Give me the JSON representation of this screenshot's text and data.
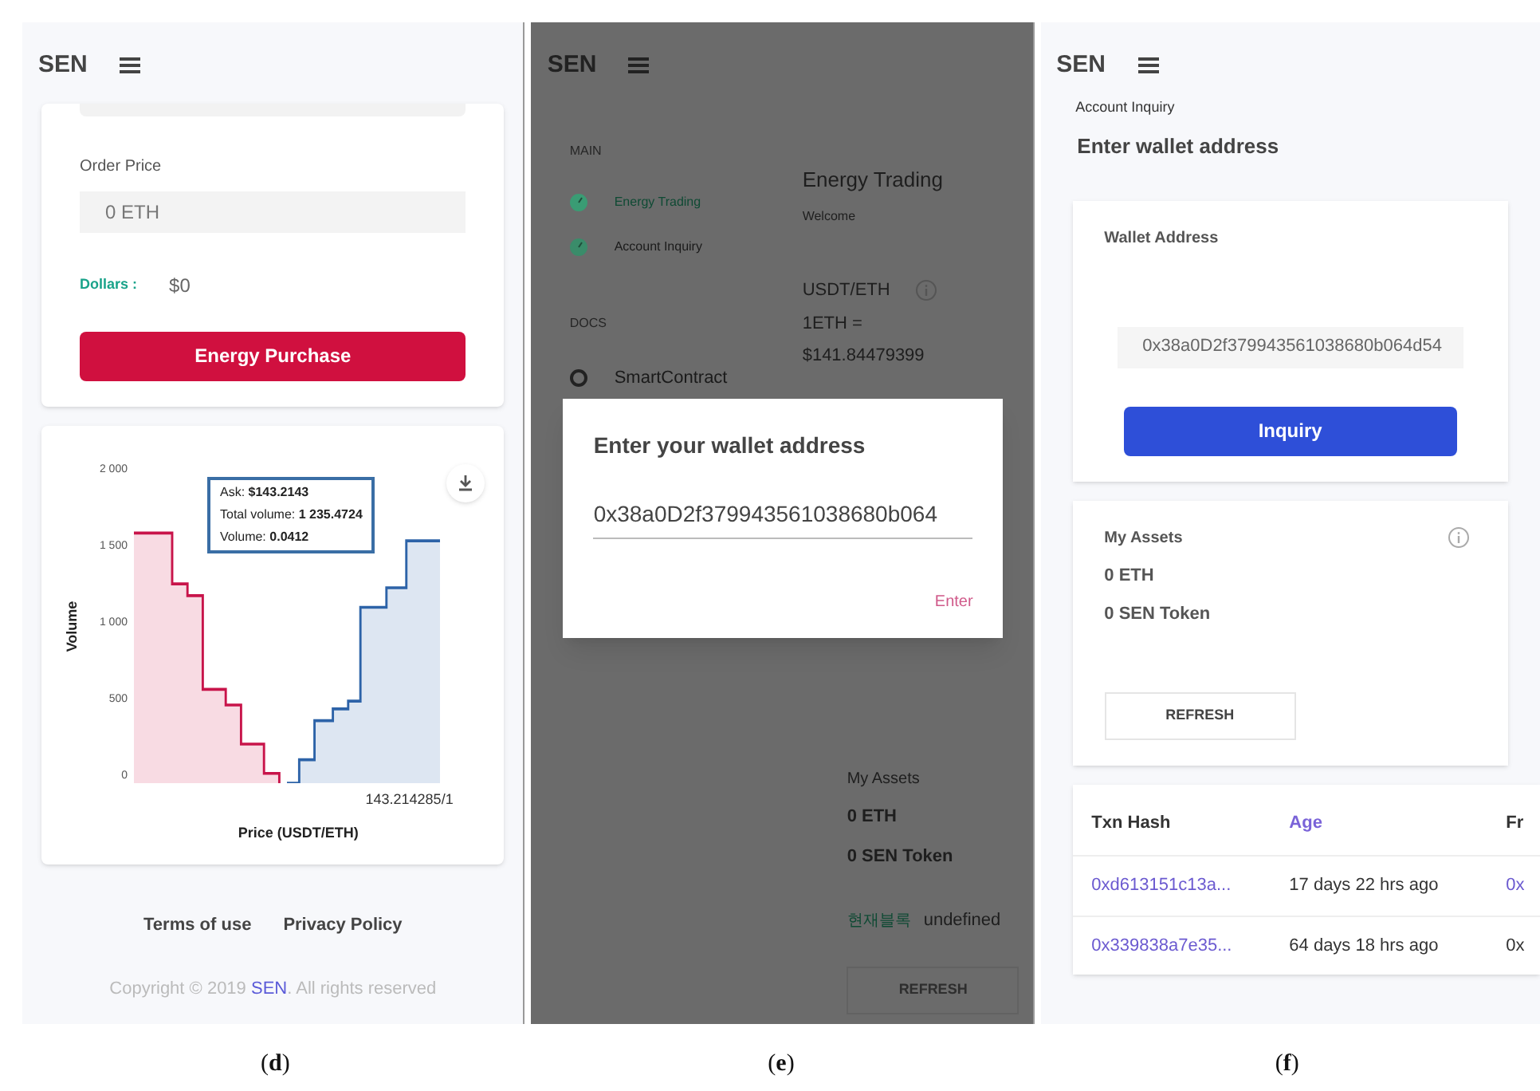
{
  "panels": [
    {
      "caption": "(**d**)",
      "brand": "SEN",
      "order_price": {
        "label": "Order Price",
        "value": "0 ETH"
      },
      "dollars": {
        "label": "Dollars :",
        "value": "$0"
      },
      "purchase_button": "Energy Purchase",
      "chart": {
        "yticks": [
          "2 000",
          "1 500",
          "1 000",
          "500",
          "0"
        ],
        "xtick": "143.214285/1",
        "xlabel": "Price (USDT/ETH)",
        "ylabel": "Volume",
        "tooltip": [
          "Ask: **$143.2143**",
          "Total volume: **1 235.4724**",
          "Volume: **0.0412**"
        ]
      },
      "footer_links": [
        "Terms of use",
        "Privacy Policy"
      ],
      "copyright": {
        "before": "Copyright © 2019 ",
        "link": "SEN",
        "after": ". All rights reserved"
      }
    },
    {
      "caption": "(**e**)",
      "brand": "SEN",
      "drawer": [
        {
          "heading": "MAIN",
          "items": [
            {
              "label": "Energy Trading",
              "selected": true,
              "kind": "gauge"
            },
            {
              "label": "Account Inquiry",
              "selected": false,
              "kind": "gauge"
            }
          ]
        },
        {
          "heading": "DOCS",
          "items": [
            {
              "label": "SmartContract",
              "selected": false,
              "kind": "ring"
            }
          ]
        }
      ],
      "content": {
        "title": "Energy Trading",
        "subtitle": "Welcome",
        "pair": "USDT/ETH",
        "rate_label": "1ETH =",
        "rate": "$141.84479399",
        "assets_title": "My Assets",
        "assets": [
          "0 ETH",
          "0 SEN Token"
        ],
        "block_label": "현재블록",
        "block_value": "undefined",
        "refresh": "REFRESH"
      },
      "dialog": {
        "title": "Enter your wallet address",
        "value": "0x38a0D2f379943561038680b064",
        "action": "Enter"
      }
    },
    {
      "caption": "(**f**)",
      "brand": "SEN",
      "page_label": "Account Inquiry",
      "heading": "Enter wallet address",
      "wallet": {
        "label": "Wallet Address",
        "value": "0x38a0D2f379943561038680b064d54",
        "button": "Inquiry"
      },
      "assets": {
        "title": "My Assets",
        "items": [
          "0 ETH",
          "0 SEN Token"
        ],
        "refresh": "REFRESH"
      },
      "table": {
        "columns": [
          {
            "label": "Txn Hash",
            "kind": "plain"
          },
          {
            "label": "Age",
            "kind": "link"
          },
          {
            "label": "Fr",
            "kind": "plain"
          }
        ],
        "rows": [
          [
            {
              "text": "0xd613151c13a...",
              "kind": "link"
            },
            {
              "text": "17 days 22 hrs ago",
              "kind": "plain"
            },
            {
              "text": "0x",
              "kind": "link"
            }
          ],
          [
            {
              "text": "0x339838a7e35...",
              "kind": "link"
            },
            {
              "text": "64 days 18 hrs ago",
              "kind": "plain"
            },
            {
              "text": "0x",
              "kind": "plain"
            }
          ]
        ]
      }
    }
  ]
}
